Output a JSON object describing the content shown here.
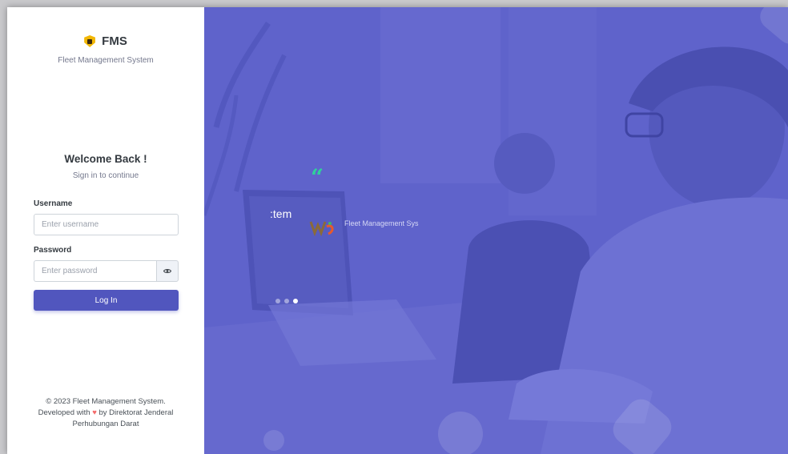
{
  "brand": {
    "name": "FMS",
    "subtitle": "Fleet Management System",
    "logo_icon": "shield-badge-icon",
    "logo_color": "#f2b705"
  },
  "login": {
    "welcome_title": "Welcome Back !",
    "welcome_subtitle": "Sign in to continue",
    "username_label": "Username",
    "username_placeholder": "Enter username",
    "username_value": "",
    "password_label": "Password",
    "password_placeholder": "Enter password",
    "password_value": "",
    "show_password_icon": "eye-icon",
    "submit_label": "Log In"
  },
  "footer": {
    "line1": "© 2023 Fleet Management System.",
    "line2_prefix": "Developed with",
    "heart": "♥",
    "line2_suffix": "by Direktorat Jenderal",
    "line3": "Perhubungan Darat"
  },
  "carousel": {
    "quote_mark": "“",
    "slide_title": ":tem",
    "slide_subtitle": "Fleet Management Sys",
    "slide_logo_icon": "hub-logo-icon",
    "dots": 3,
    "active_dot": 3
  },
  "colors": {
    "primary": "#5156be",
    "accent_green": "#2fd19a",
    "heart": "#f46a6a",
    "overlay": "#5b5fc6"
  }
}
